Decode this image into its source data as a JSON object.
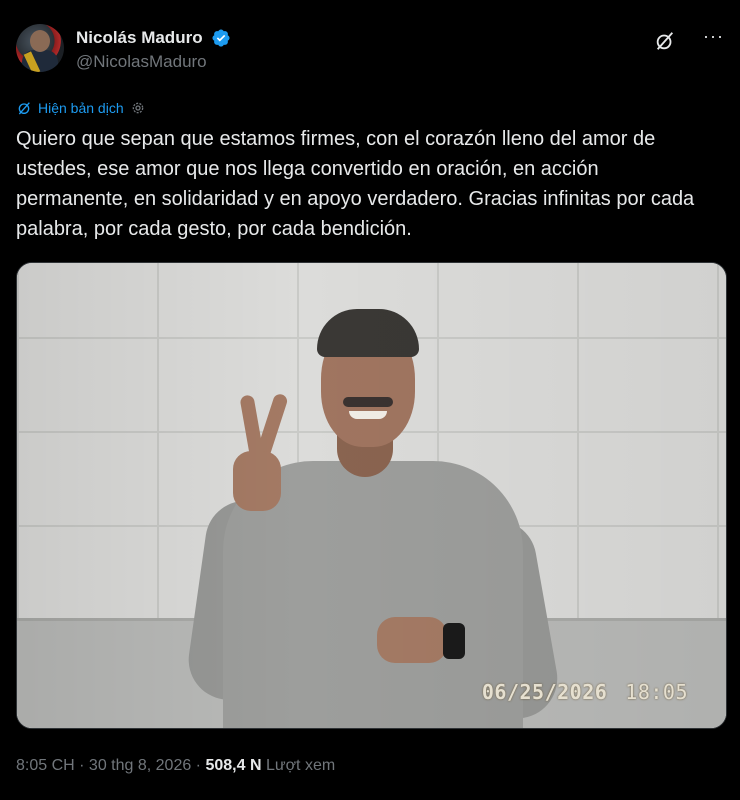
{
  "author": {
    "display_name": "Nicolás Maduro",
    "handle": "@NicolasMaduro",
    "verified": true,
    "avatar": "profile-photo"
  },
  "actions": {
    "grok_icon": "grok-icon",
    "more_label": "···"
  },
  "translate": {
    "icon": "translate-icon",
    "label": "Hiện bản dịch",
    "settings_icon": "gear-icon"
  },
  "tweet": {
    "text": "Quiero que sepan que estamos firmes, con el corazón lleno del amor de ustedes, ese amor que nos llega convertido en oración, en acción permanente, en solidaridad y en apoyo verdadero. Gracias infinitas por cada palabra, por cada gesto, por cada bendición."
  },
  "media": {
    "type": "photo",
    "date_stamp": "06/25/2026",
    "time_stamp": "18:05"
  },
  "footer": {
    "time": "8:05 CH",
    "separator1": " · ",
    "date": "30 thg 8, 2026",
    "separator2": " · ",
    "views_count": "508,4 N",
    "views_label": "Lượt xem"
  },
  "colors": {
    "background": "#000000",
    "text": "#e7e9ea",
    "secondary": "#71767b",
    "accent": "#1d9bf0"
  }
}
